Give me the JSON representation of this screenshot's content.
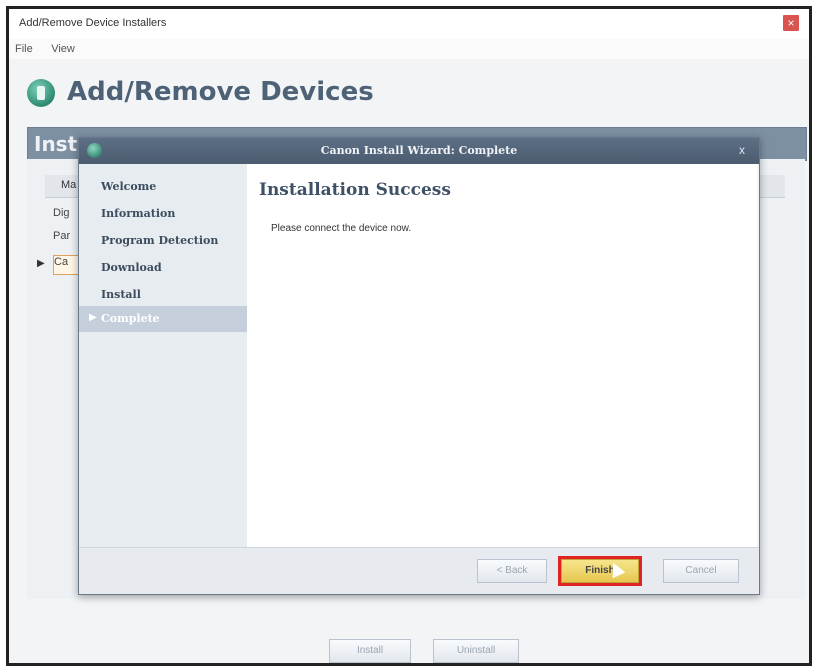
{
  "window": {
    "title": "Add/Remove Device Installers",
    "close_label": "×",
    "menu": [
      "File",
      "View"
    ]
  },
  "app": {
    "heading": "Add/Remove Devices",
    "section_title": "Inst",
    "list_header": "Ma",
    "rows": [
      "Dig",
      "Par",
      "Ca"
    ]
  },
  "wizard": {
    "title": "Canon Install Wizard: Complete",
    "close_label": "x",
    "steps": [
      "Welcome",
      "Information",
      "Program Detection",
      "Download",
      "Install",
      "Complete"
    ],
    "active_step": "Complete",
    "content_title": "Installation Success",
    "content_text": "Please connect the device now.",
    "buttons": {
      "back": "< Back",
      "finish": "Finish",
      "cancel": "Cancel"
    }
  },
  "footer_buttons": {
    "install": "Install",
    "uninstall": "Uninstall"
  }
}
